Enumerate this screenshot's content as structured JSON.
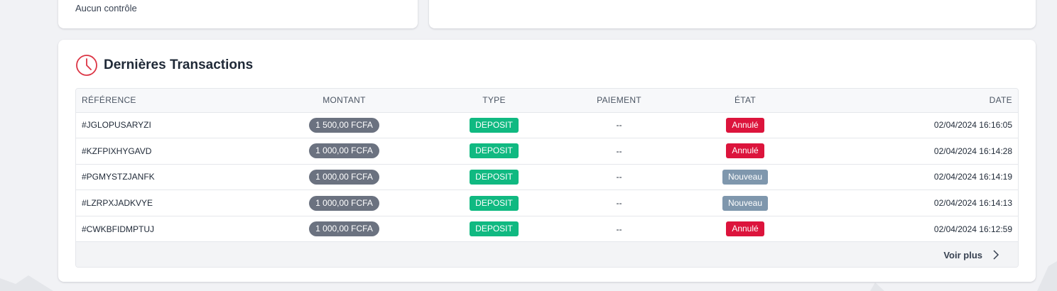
{
  "top_card": {
    "text": "Aucun contrôle"
  },
  "transactions": {
    "title": "Dernières Transactions",
    "icon": "clock-icon",
    "accent_color": "#dc3545",
    "columns": {
      "reference": "RÉFÉRENCE",
      "amount": "MONTANT",
      "type": "TYPE",
      "payment": "PAIEMENT",
      "state": "ÉTAT",
      "date": "DATE"
    },
    "rows": [
      {
        "reference": "#JGLOPUSARYZI",
        "amount": "1 500,00 FCFA",
        "type": "DEPOSIT",
        "payment": "--",
        "state": "Annulé",
        "state_kind": "annule",
        "date": "02/04/2024 16:16:05"
      },
      {
        "reference": "#KZFPIXHYGAVD",
        "amount": "1 000,00 FCFA",
        "type": "DEPOSIT",
        "payment": "--",
        "state": "Annulé",
        "state_kind": "annule",
        "date": "02/04/2024 16:14:28"
      },
      {
        "reference": "#PGMYSTZJANFK",
        "amount": "1 000,00 FCFA",
        "type": "DEPOSIT",
        "payment": "--",
        "state": "Nouveau",
        "state_kind": "nouveau",
        "date": "02/04/2024 16:14:19"
      },
      {
        "reference": "#LZRPXJADKVYE",
        "amount": "1 000,00 FCFA",
        "type": "DEPOSIT",
        "payment": "--",
        "state": "Nouveau",
        "state_kind": "nouveau",
        "date": "02/04/2024 16:14:13"
      },
      {
        "reference": "#CWKBFIDMPTUJ",
        "amount": "1 000,00 FCFA",
        "type": "DEPOSIT",
        "payment": "--",
        "state": "Annulé",
        "state_kind": "annule",
        "date": "02/04/2024 16:12:59"
      }
    ],
    "see_more_label": "Voir plus",
    "see_more_icon": "chevron-right-icon"
  },
  "colors": {
    "deposit": "#10b981",
    "annule": "#dc143c",
    "nouveau": "#7f97ad",
    "amount_pill": "#6b7280"
  }
}
